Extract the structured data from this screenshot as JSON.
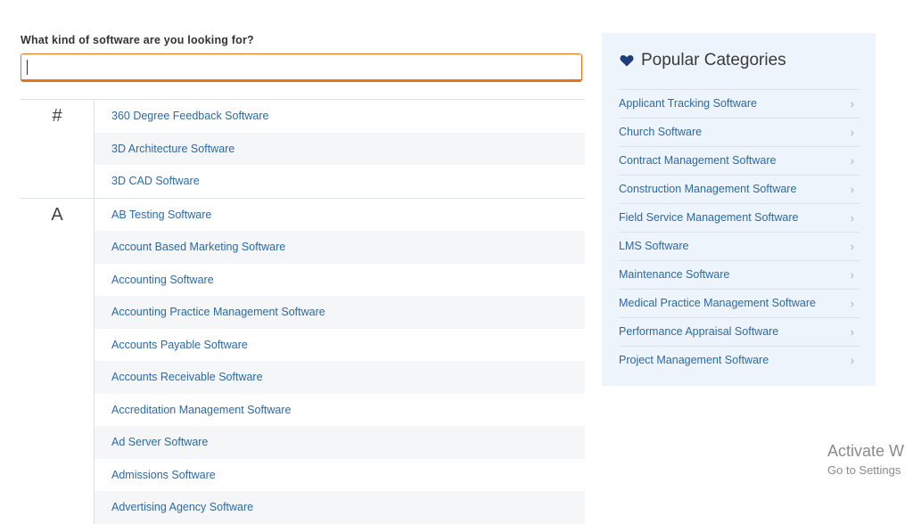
{
  "search": {
    "label": "What kind of software are you looking for?",
    "value": "",
    "placeholder": ""
  },
  "directory": [
    {
      "letter": "#",
      "items": [
        "360 Degree Feedback Software",
        "3D Architecture Software",
        "3D CAD Software"
      ]
    },
    {
      "letter": "A",
      "items": [
        "AB Testing Software",
        "Account Based Marketing Software",
        "Accounting Software",
        "Accounting Practice Management Software",
        "Accounts Payable Software",
        "Accounts Receivable Software",
        "Accreditation Management Software",
        "Ad Server Software",
        "Admissions Software",
        "Advertising Agency Software"
      ]
    }
  ],
  "popular": {
    "title": "Popular Categories",
    "icon": "heart-icon",
    "items": [
      "Applicant Tracking Software",
      "Church Software",
      "Contract Management Software",
      "Construction Management Software",
      "Field Service Management Software",
      "LMS Software",
      "Maintenance Software",
      "Medical Practice Management Software",
      "Performance Appraisal Software",
      "Project Management Software"
    ]
  },
  "watermark": {
    "line1": "Activate W",
    "line2": "Go to Settings"
  },
  "colors": {
    "accent": "#e8711c",
    "link": "#2a6aa5",
    "panel_bg": "#eef4fb",
    "heart": "#1e3d7a"
  }
}
